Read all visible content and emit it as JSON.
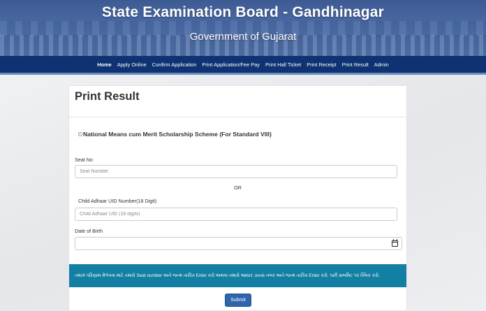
{
  "header": {
    "title": "State Examination Board - Gandhinagar",
    "subtitle": "Government of Gujarat"
  },
  "nav": {
    "items": [
      "Home",
      "Apply Online",
      "Confirm Application",
      "Print Application/Fee Pay",
      "Print Hall Ticket",
      "Print Receipt",
      "Print Result",
      "Admin"
    ],
    "active": "Home"
  },
  "form": {
    "title": "Print Result",
    "scheme_label": "National Means cum Merit Scholarship Scheme (For Standard VIII)",
    "seat_label": "Seat No",
    "seat_placeholder": "Seat Number",
    "or_text": "OR",
    "uid_label": "Child Adhaar UID Number(18 Digit)",
    "uid_placeholder": "Child Adhaar UID (18 digits)",
    "dob_label": "Date of Birth",
    "notice": "તમારું પરિણામ મેળવવા માટે તમારો Seat number અને જન્મ તારીખ Enter કરો અથવા તમારો આધાર ડાયસ નંબર અને જન્મ તારીખ Enter કરો. પછી સબમિટ પર ક્લિક કરો.",
    "submit_label": "Submit"
  },
  "colors": {
    "navbar": "#0e3272",
    "notice": "#137fa3",
    "submit": "#2f65ad"
  }
}
